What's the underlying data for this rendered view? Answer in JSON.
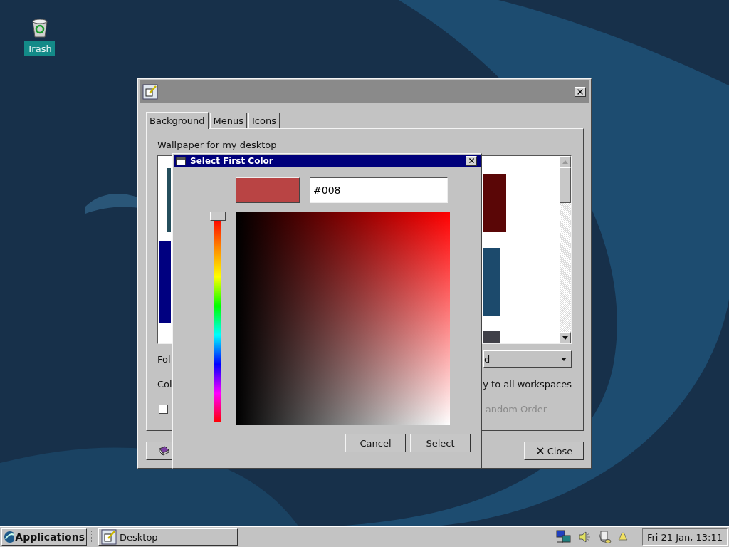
{
  "desktop_icons": [
    {
      "label": "Trash"
    }
  ],
  "settings_window": {
    "tabs": [
      {
        "label": "Background",
        "selected": true
      },
      {
        "label": "Menus",
        "selected": false
      },
      {
        "label": "Icons",
        "selected": false
      }
    ],
    "wallpaper_label": "Wallpaper for my desktop",
    "row_1_label": "Fol",
    "dropdown": {
      "value": "d"
    },
    "row_2_label": "Col",
    "apply_all": {
      "label": "y to all workspaces"
    },
    "checkbox": {
      "checked": false
    },
    "random_order": {
      "label": "andom Order",
      "disabled": true
    },
    "close_button": "Close"
  },
  "color_dialog": {
    "title": "Select First Color",
    "hex_input": {
      "value": "#008"
    },
    "hue_slider": {
      "level": 0
    },
    "buttons": [
      "Cancel",
      "Select"
    ]
  },
  "taskbar": {
    "start_button": "Applications",
    "tasks": [
      {
        "label": "Desktop",
        "selected": false
      }
    ],
    "clock": "Fri 21 Jan, 13:11"
  }
}
